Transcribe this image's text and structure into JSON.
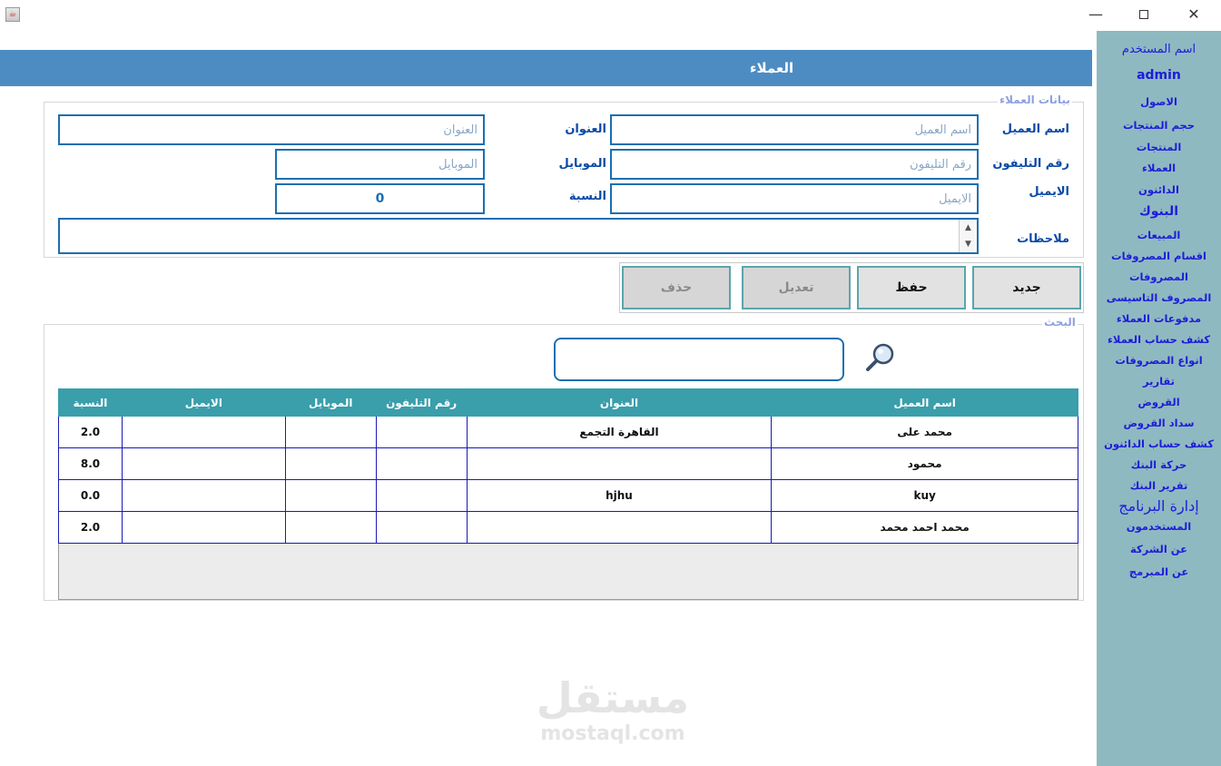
{
  "window": {
    "title": "",
    "minimize": "—",
    "close": "✕"
  },
  "header": {
    "title": "العملاء"
  },
  "sidebar": {
    "user_caption": "اسم المستخدم",
    "user_name": "admin",
    "items": [
      "الاصول",
      "حجم المنتجات",
      "المنتجات",
      "العملاء",
      "الدائنون",
      "البنوك",
      "المبيعات",
      "اقسام المصروفات",
      "المصروفات",
      "المصروف التاسيسى",
      "مدفوعات العملاء",
      "كشف حساب العملاء",
      "انواع المصروفات",
      "تقارير",
      "القروض",
      "سداد القروض",
      "كشف حساب الدائنون",
      "حركة البنك",
      "تقرير البنك",
      "إدارة البرنامج",
      "المستخدمون",
      "عن الشركة",
      "عن المبرمج"
    ]
  },
  "form": {
    "legend": "بيانات العملاء",
    "labels": {
      "name": "اسم العميل",
      "address": "العنوان",
      "phone": "رقم التليفون",
      "mobile": "الموبايل",
      "email": "الايميل",
      "ratio": "النسبة",
      "notes": "ملاحظات"
    },
    "placeholders": {
      "name": "اسم العميل",
      "address": "العنوان",
      "phone": "رقم التليفون",
      "mobile": "الموبايل",
      "email": "الايميل"
    },
    "ratio_value": "0"
  },
  "buttons": {
    "new": "جديد",
    "save": "حفظ",
    "edit": "تعديل",
    "delete": "حذف"
  },
  "search": {
    "legend": "البحث"
  },
  "table": {
    "headers": [
      "النسبة",
      "الايميل",
      "الموبايل",
      "رقم التليفون",
      "العنوان",
      "اسم العميل"
    ],
    "rows": [
      [
        "2.0",
        "",
        "",
        "",
        "القاهرة التجمع",
        "محمد على"
      ],
      [
        "8.0",
        "",
        "",
        "",
        "",
        "محمود"
      ],
      [
        "0.0",
        "",
        "",
        "",
        "hjhu",
        "kuy"
      ],
      [
        "2.0",
        "",
        "",
        "",
        "",
        "محمد احمد محمد"
      ]
    ]
  },
  "watermark": {
    "arabic": "مستقل",
    "latin": "mostaql.com"
  }
}
